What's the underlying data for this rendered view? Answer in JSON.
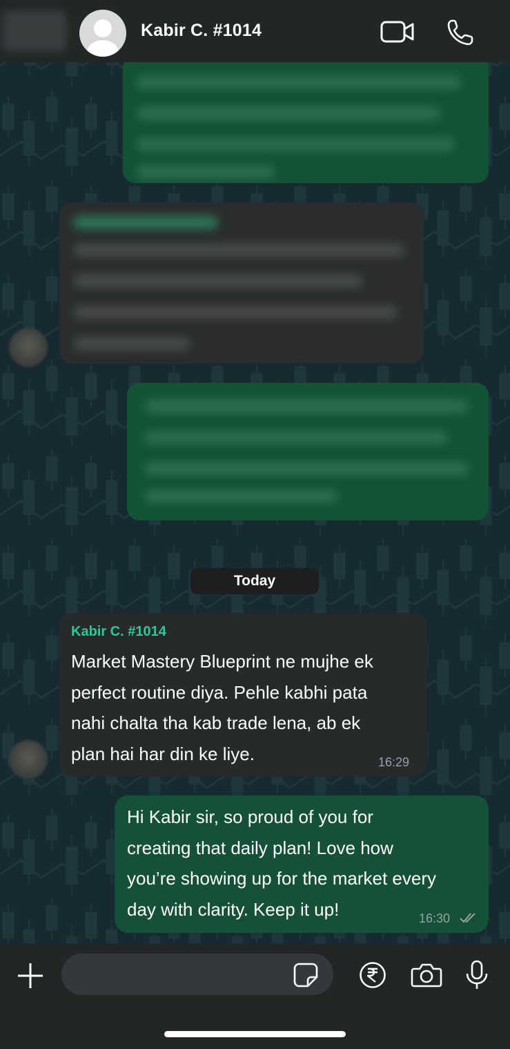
{
  "header": {
    "contact_name": "Kabir C. #1014",
    "icons": {
      "back": "back-area",
      "avatar": "default-avatar",
      "video": "video-call-icon",
      "phone": "phone-call-icon"
    }
  },
  "date_divider": "Today",
  "messages": [
    {
      "direction": "incoming",
      "sender": "Kabir C. #1014",
      "text_lines": [
        "Market Mastery Blueprint ne mujhe ek",
        "perfect routine diya. Pehle kabhi pata",
        "nahi chalta tha kab trade lena, ab ek",
        "plan hai har din ke liye."
      ],
      "time": "16:29"
    },
    {
      "direction": "outgoing",
      "text_lines": [
        "Hi Kabir sir, so proud of you for",
        "creating that daily plan! Love how",
        "you’re showing up for the market every",
        "day with clarity. Keep it up!"
      ],
      "time": "16:30",
      "status": "read"
    }
  ],
  "input": {
    "placeholder": ""
  },
  "colors": {
    "header_bg": "#232627",
    "chat_bg": "#172a30",
    "incoming_bubble": "#272a2b",
    "outgoing_bubble": "#155038",
    "sender_name": "#2ec79a",
    "read_tick": "#9aa0a3"
  }
}
